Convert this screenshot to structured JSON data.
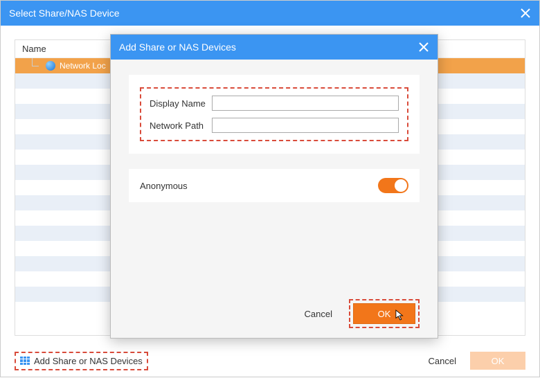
{
  "outer": {
    "title": "Select Share/NAS Device",
    "tree": {
      "header": "Name",
      "selected_item": "Network Loc"
    },
    "footer": {
      "add_label": "Add Share or NAS Devices",
      "cancel": "Cancel",
      "ok": "OK"
    }
  },
  "modal": {
    "title": "Add Share or NAS Devices",
    "form": {
      "display_name_label": "Display Name",
      "display_name_value": "",
      "network_path_label": "Network Path",
      "network_path_value": ""
    },
    "anonymous_label": "Anonymous",
    "anonymous_on": true,
    "cancel": "Cancel",
    "ok": "OK"
  }
}
